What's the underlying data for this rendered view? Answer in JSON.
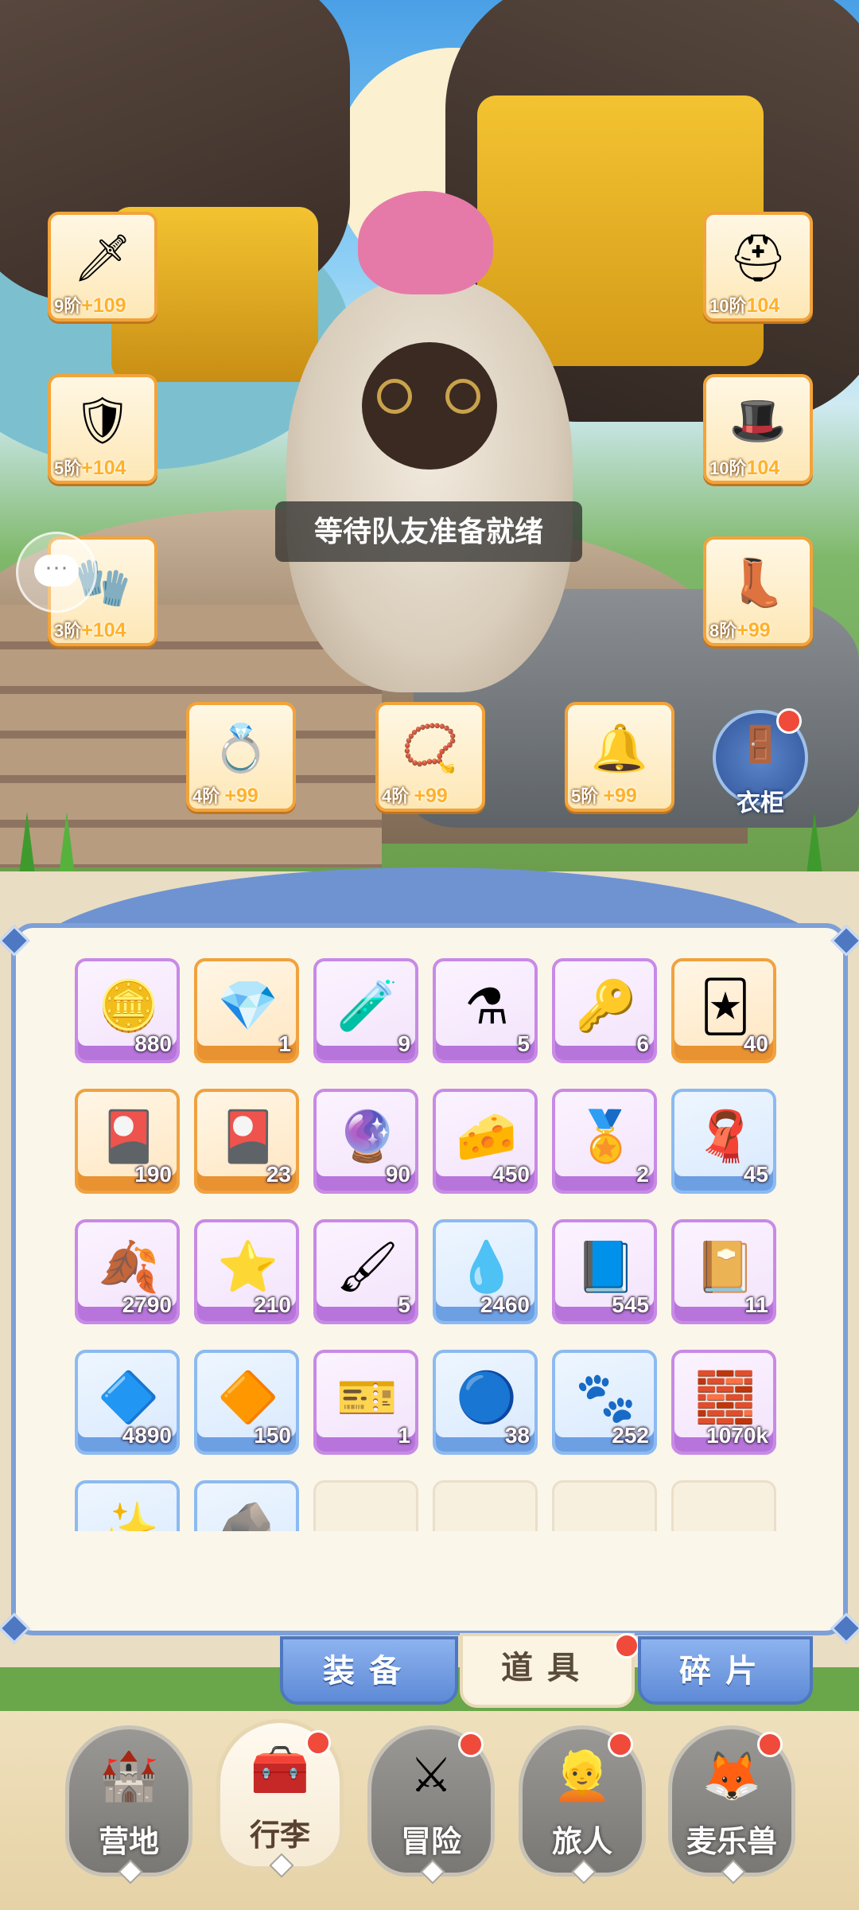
{
  "status": {
    "waiting_message": "等待队友准备就绪"
  },
  "equipment": [
    {
      "slot": "weapon",
      "icon": "sword-icon",
      "tier": "9阶",
      "plus": "+109"
    },
    {
      "slot": "chest",
      "icon": "chest-armor-icon",
      "tier": "5阶",
      "plus": "+104"
    },
    {
      "slot": "bracer",
      "icon": "gauntlet-icon",
      "tier": "3阶",
      "plus": "+104"
    },
    {
      "slot": "helmet",
      "icon": "helmet-icon",
      "tier": "10阶",
      "plus": "104"
    },
    {
      "slot": "hat",
      "icon": "feather-hat-icon",
      "tier": "10阶",
      "plus": "104"
    },
    {
      "slot": "boots",
      "icon": "boots-icon",
      "tier": "8阶",
      "plus": "+99"
    },
    {
      "slot": "ring",
      "icon": "ring-icon",
      "tier": "4阶",
      "plus": "+99"
    },
    {
      "slot": "necklace",
      "icon": "necklace-icon",
      "tier": "4阶",
      "plus": "+99"
    },
    {
      "slot": "charm",
      "icon": "charm-icon",
      "tier": "5阶",
      "plus": "+99"
    }
  ],
  "wardrobe": {
    "label": "衣柜",
    "icon": "wardrobe-icon",
    "has_alert": true
  },
  "chat": {
    "icon": "chat-icon"
  },
  "inventory": [
    {
      "icon": "coin-icon",
      "qty": "880",
      "rarity": "purple"
    },
    {
      "icon": "crystal-icon",
      "qty": "1",
      "rarity": "orange"
    },
    {
      "icon": "blue-potion-icon",
      "qty": "9",
      "rarity": "purple"
    },
    {
      "icon": "red-potion-icon",
      "qty": "5",
      "rarity": "purple"
    },
    {
      "icon": "golden-key-icon",
      "qty": "6",
      "rarity": "purple"
    },
    {
      "icon": "blue-card-icon",
      "qty": "40",
      "rarity": "orange"
    },
    {
      "icon": "gold-card-icon",
      "qty": "190",
      "rarity": "orange"
    },
    {
      "icon": "red-card-icon",
      "qty": "23",
      "rarity": "orange"
    },
    {
      "icon": "cat-orb-icon",
      "qty": "90",
      "rarity": "purple"
    },
    {
      "icon": "cheese-icon",
      "qty": "450",
      "rarity": "purple"
    },
    {
      "icon": "emblem-icon",
      "qty": "2",
      "rarity": "purple"
    },
    {
      "icon": "scarf-icon",
      "qty": "45",
      "rarity": "blue"
    },
    {
      "icon": "golden-leaf-icon",
      "qty": "2790",
      "rarity": "purple"
    },
    {
      "icon": "star-badge-icon",
      "qty": "210",
      "rarity": "purple"
    },
    {
      "icon": "paint-tube-icon",
      "qty": "5",
      "rarity": "purple"
    },
    {
      "icon": "slime-icon",
      "qty": "2460",
      "rarity": "blue"
    },
    {
      "icon": "recipe-book-icon",
      "qty": "545",
      "rarity": "purple"
    },
    {
      "icon": "journal-icon",
      "qty": "11",
      "rarity": "purple"
    },
    {
      "icon": "blue-gem-icon",
      "qty": "4890",
      "rarity": "blue"
    },
    {
      "icon": "amber-icon",
      "qty": "150",
      "rarity": "blue"
    },
    {
      "icon": "ticket-icon",
      "qty": "1",
      "rarity": "purple"
    },
    {
      "icon": "cat-lens-icon",
      "qty": "38",
      "rarity": "blue"
    },
    {
      "icon": "paw-sack-icon",
      "qty": "252",
      "rarity": "blue"
    },
    {
      "icon": "iron-ingot-icon",
      "qty": "1070k",
      "rarity": "purple"
    },
    {
      "icon": "gold-fragment-icon",
      "qty": "",
      "rarity": "blue"
    },
    {
      "icon": "dark-stone-icon",
      "qty": "",
      "rarity": "blue"
    },
    {
      "icon": "",
      "qty": "",
      "rarity": "empty"
    },
    {
      "icon": "",
      "qty": "",
      "rarity": "empty"
    },
    {
      "icon": "",
      "qty": "",
      "rarity": "empty"
    },
    {
      "icon": "",
      "qty": "",
      "rarity": "empty"
    }
  ],
  "tabs": [
    {
      "label": "装备",
      "active": false,
      "has_alert": false
    },
    {
      "label": "道具",
      "active": true,
      "has_alert": true
    },
    {
      "label": "碎片",
      "active": false,
      "has_alert": false
    }
  ],
  "nav": [
    {
      "label": "营地",
      "icon": "castle-icon",
      "active": false,
      "has_alert": false
    },
    {
      "label": "行李",
      "icon": "chest-icon",
      "active": true,
      "has_alert": true
    },
    {
      "label": "冒险",
      "icon": "crossed-swords-icon",
      "active": false,
      "has_alert": true
    },
    {
      "label": "旅人",
      "icon": "traveler-icon",
      "active": false,
      "has_alert": true
    },
    {
      "label": "麦乐兽",
      "icon": "fox-icon",
      "active": false,
      "has_alert": true
    }
  ],
  "colors": {
    "accent_orange": "#f0a23f",
    "rarity_purple": "#c88ae6",
    "rarity_blue": "#8cbaf2",
    "alert_red": "#ef4a3a",
    "tab_blue": "#5e8ad6"
  }
}
